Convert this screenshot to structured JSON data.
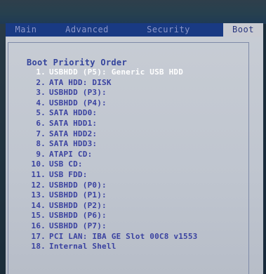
{
  "tabs": [
    {
      "label": "Main"
    },
    {
      "label": "Advanced"
    },
    {
      "label": "Security"
    },
    {
      "label": "Boot"
    }
  ],
  "active_tab": "Boot",
  "section_title": "Boot Priority Order",
  "boot_items": [
    {
      "num": "1.",
      "label": "USBHDD (P5): Generic USB HDD",
      "selected": true
    },
    {
      "num": "2.",
      "label": "ATA HDD: DISK"
    },
    {
      "num": "3.",
      "label": "USBHDD (P3):"
    },
    {
      "num": "4.",
      "label": "USBHDD (P4):"
    },
    {
      "num": "5.",
      "label": "SATA HDD0:"
    },
    {
      "num": "6.",
      "label": "SATA HDD1:"
    },
    {
      "num": "7.",
      "label": "SATA HDD2:"
    },
    {
      "num": "8.",
      "label": "SATA HDD3:"
    },
    {
      "num": "9.",
      "label": "ATAPI CD:"
    },
    {
      "num": "10.",
      "label": "USB CD:"
    },
    {
      "num": "11.",
      "label": "USB FDD:"
    },
    {
      "num": "12.",
      "label": "USBHDD (P0):"
    },
    {
      "num": "13.",
      "label": "USBHDD (P1):"
    },
    {
      "num": "14.",
      "label": "USBHDD (P2):"
    },
    {
      "num": "15.",
      "label": "USBHDD (P6):"
    },
    {
      "num": "16.",
      "label": "USBHDD (P7):"
    },
    {
      "num": "17.",
      "label": "PCI LAN: IBA GE Slot 00C8 v1553"
    },
    {
      "num": "18.",
      "label": "Internal Shell"
    }
  ],
  "colors": {
    "tab_bar": "#193a83",
    "active_tab_bg": "#c9cbd2",
    "content_bg": "#c4c9d2",
    "item_text": "#3a42a0",
    "selected_text": "#ffffff"
  }
}
